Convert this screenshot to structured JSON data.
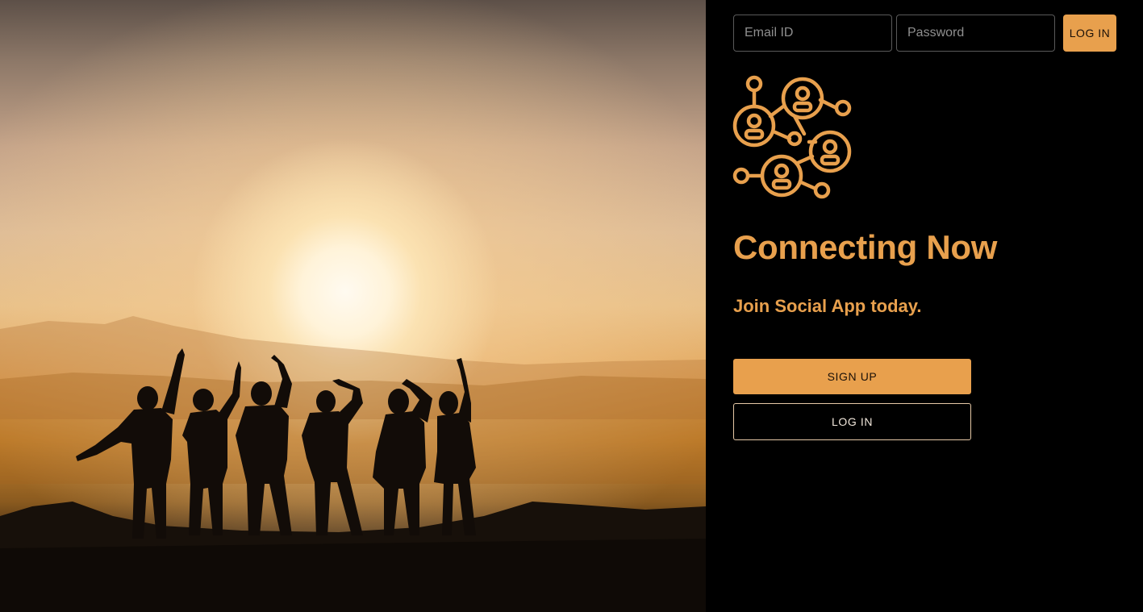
{
  "hero": {
    "image": "group-of-friends-silhouette-at-sunset"
  },
  "header": {
    "email_placeholder": "Email ID",
    "password_placeholder": "Password",
    "login_label": "LOG IN"
  },
  "brand": {
    "logo_icon": "social-network-icon",
    "headline": "Connecting Now",
    "tagline": "Join Social App today."
  },
  "actions": {
    "signup_label": "SIGN UP",
    "login_label": "LOG IN"
  },
  "colors": {
    "accent": "#e8a04d",
    "background": "#000000"
  }
}
